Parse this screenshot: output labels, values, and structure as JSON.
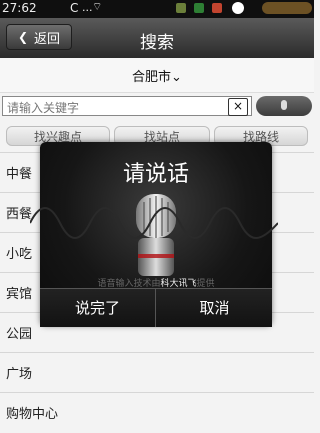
{
  "status_bar": {
    "time": "27:62",
    "carrier_icon": "C",
    "signal_icon": "...",
    "wifi_icon": "wifi"
  },
  "header": {
    "back_label": "返回",
    "title": "搜索"
  },
  "city_selector": {
    "city": "合肥市"
  },
  "search": {
    "placeholder": "请输入关键字",
    "clear_label": "×"
  },
  "tabs": [
    {
      "label": "找兴趣点"
    },
    {
      "label": "找站点"
    },
    {
      "label": "找路线"
    }
  ],
  "categories": [
    "中餐",
    "西餐",
    "小吃",
    "宾馆",
    "公园",
    "广场",
    "购物中心"
  ],
  "voice_dialog": {
    "prompt": "请说话",
    "provider_text_prefix": "语音输入技术由",
    "provider_brand": "科大讯飞",
    "provider_text_suffix": "提供",
    "done_label": "说完了",
    "cancel_label": "取消"
  }
}
